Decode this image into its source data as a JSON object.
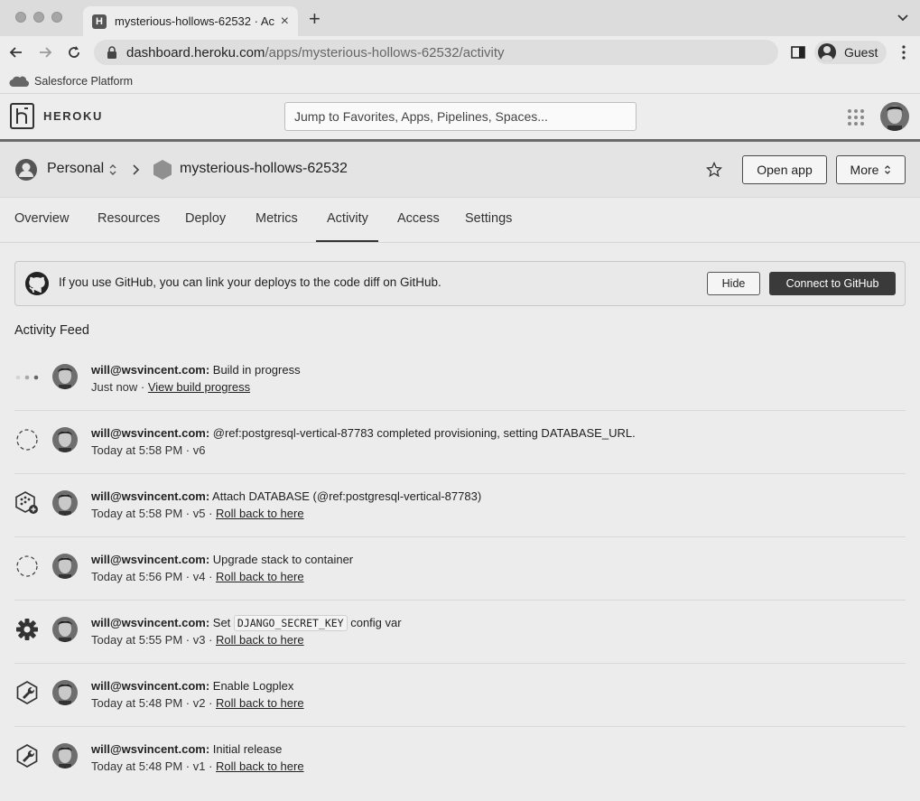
{
  "browser": {
    "tab_title": "mysterious-hollows-62532 · Ac",
    "tab_favicon_letter": "H",
    "url_host": "dashboard.heroku.com",
    "url_path": "/apps/mysterious-hollows-62532/activity",
    "profile_label": "Guest",
    "bookmark": "Salesforce Platform"
  },
  "heroku": {
    "wordmark": "HEROKU",
    "search_placeholder": "Jump to Favorites, Apps, Pipelines, Spaces..."
  },
  "app_header": {
    "account": "Personal",
    "app_name": "mysterious-hollows-62532",
    "open_app": "Open app",
    "more": "More"
  },
  "tabs": [
    "Overview",
    "Resources",
    "Deploy",
    "Metrics",
    "Activity",
    "Access",
    "Settings"
  ],
  "active_tab": "Activity",
  "github_banner": {
    "text": "If you use GitHub, you can link your deploys to the code diff on GitHub.",
    "hide": "Hide",
    "connect": "Connect to GitHub"
  },
  "feed": {
    "title": "Activity Feed",
    "items": [
      {
        "icon": "in-progress-dots-icon",
        "user": "will@wsvincent.com:",
        "text": " Build in progress",
        "time": "Just now · ",
        "link": "View build progress"
      },
      {
        "icon": "dashed-circle-icon",
        "user": "will@wsvincent.com:",
        "text": " @ref:postgresql-vertical-87783 completed provisioning, setting DATABASE_URL.",
        "time": "Today at 5:58 PM · v6",
        "link": ""
      },
      {
        "icon": "addon-attach-icon",
        "user": "will@wsvincent.com:",
        "text": " Attach DATABASE (@ref:postgresql-vertical-87783)",
        "time": "Today at 5:58 PM · v5 · ",
        "link": "Roll back to here"
      },
      {
        "icon": "dashed-circle-icon",
        "user": "will@wsvincent.com:",
        "text": " Upgrade stack to container",
        "time": "Today at 5:56 PM · v4 · ",
        "link": "Roll back to here"
      },
      {
        "icon": "gear-icon",
        "user": "will@wsvincent.com:",
        "text_before": " Set ",
        "code": "DJANGO_SECRET_KEY",
        "text_after": " config var",
        "time": "Today at 5:55 PM · v3 · ",
        "link": "Roll back to here"
      },
      {
        "icon": "wrench-hex-icon",
        "user": "will@wsvincent.com:",
        "text": " Enable Logplex",
        "time": "Today at 5:48 PM · v2 · ",
        "link": "Roll back to here"
      },
      {
        "icon": "wrench-hex-icon",
        "user": "will@wsvincent.com:",
        "text": " Initial release",
        "time": "Today at 5:48 PM · v1 · ",
        "link": "Roll back to here"
      }
    ]
  }
}
